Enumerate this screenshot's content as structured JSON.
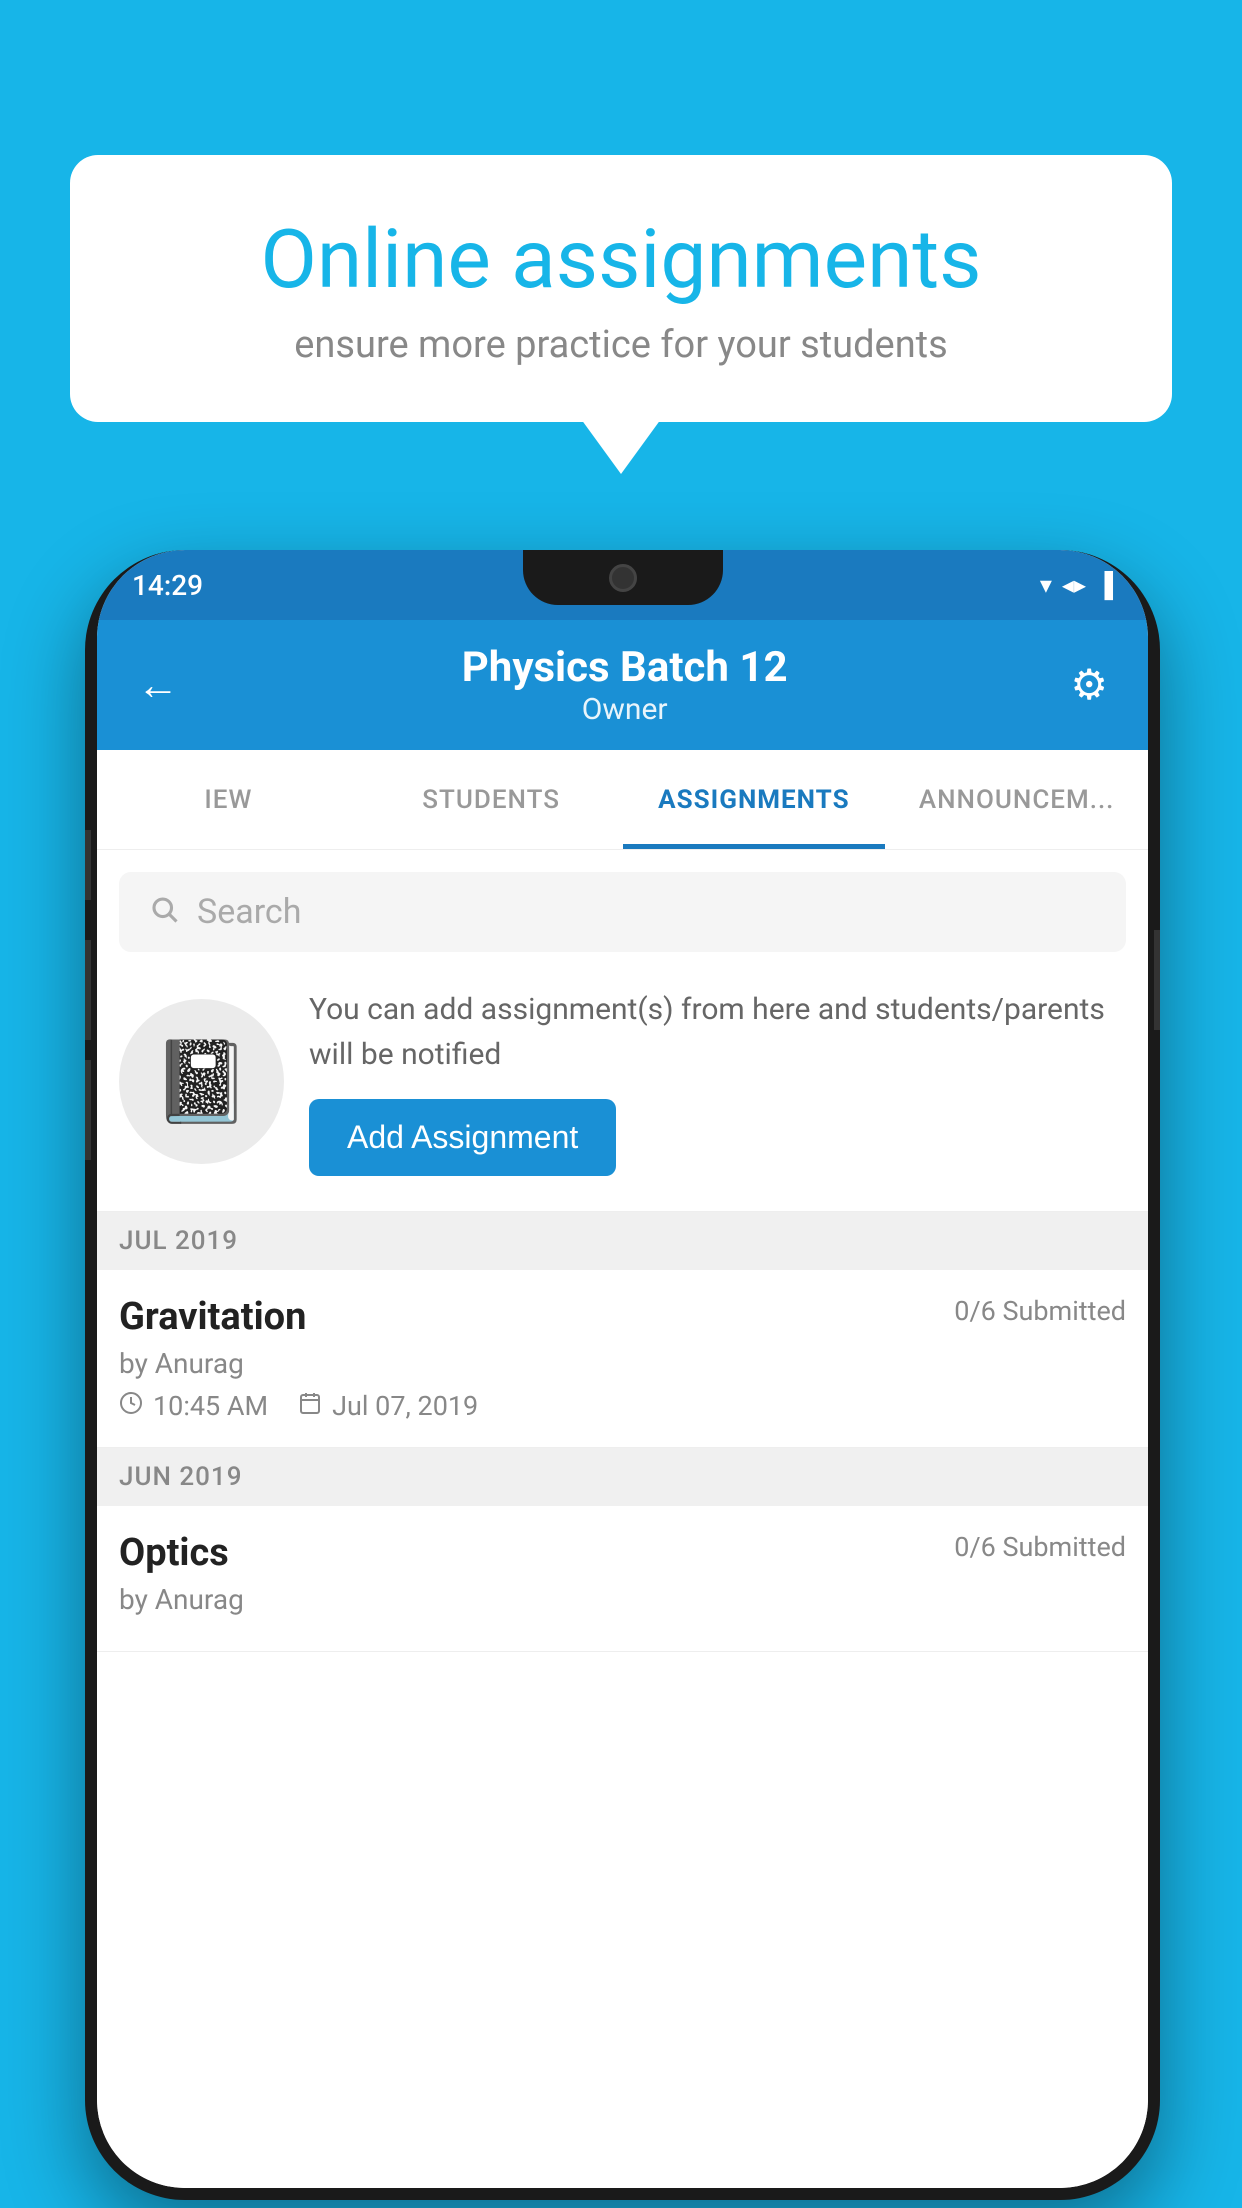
{
  "background_color": "#17b5e8",
  "speech_bubble": {
    "title": "Online assignments",
    "subtitle": "ensure more practice for your students"
  },
  "status_bar": {
    "time": "14:29",
    "icons": [
      "wifi",
      "signal",
      "battery"
    ]
  },
  "app_bar": {
    "title": "Physics Batch 12",
    "subtitle": "Owner",
    "back_label": "←",
    "settings_label": "⚙"
  },
  "tabs": [
    {
      "label": "IEW",
      "active": false
    },
    {
      "label": "STUDENTS",
      "active": false
    },
    {
      "label": "ASSIGNMENTS",
      "active": true
    },
    {
      "label": "ANNOUNCEM...",
      "active": false
    }
  ],
  "search": {
    "placeholder": "Search"
  },
  "add_assignment_section": {
    "description": "You can add assignment(s) from here and students/parents will be notified",
    "button_label": "Add Assignment"
  },
  "sections": [
    {
      "header": "JUL 2019",
      "items": [
        {
          "name": "Gravitation",
          "submitted": "0/6 Submitted",
          "by": "by Anurag",
          "time": "10:45 AM",
          "date": "Jul 07, 2019"
        }
      ]
    },
    {
      "header": "JUN 2019",
      "items": [
        {
          "name": "Optics",
          "submitted": "0/6 Submitted",
          "by": "by Anurag",
          "time": "",
          "date": ""
        }
      ]
    }
  ]
}
